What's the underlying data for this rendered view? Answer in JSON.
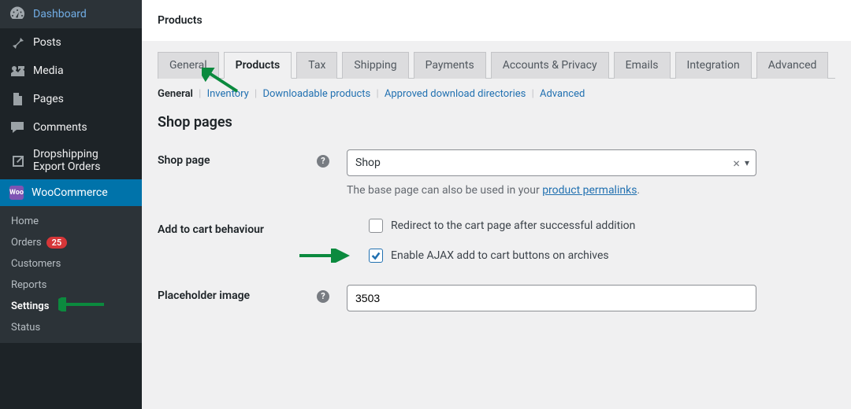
{
  "sidebar": {
    "main": [
      {
        "name": "dashboard",
        "label": "Dashboard",
        "icon": "gauge"
      },
      {
        "name": "posts",
        "label": "Posts",
        "icon": "pin"
      },
      {
        "name": "media",
        "label": "Media",
        "icon": "media"
      },
      {
        "name": "pages",
        "label": "Pages",
        "icon": "page"
      },
      {
        "name": "comments",
        "label": "Comments",
        "icon": "comment"
      },
      {
        "name": "dropshipping",
        "label": "Dropshipping Export Orders",
        "icon": "export"
      }
    ],
    "woo": {
      "label": "WooCommerce",
      "active": true
    },
    "sub": [
      {
        "name": "home",
        "label": "Home"
      },
      {
        "name": "orders",
        "label": "Orders",
        "badge": "25"
      },
      {
        "name": "customers",
        "label": "Customers"
      },
      {
        "name": "reports",
        "label": "Reports"
      },
      {
        "name": "settings",
        "label": "Settings",
        "current": true
      },
      {
        "name": "status",
        "label": "Status"
      }
    ]
  },
  "topbar": {
    "title": "Products"
  },
  "tabs": [
    {
      "label": "General"
    },
    {
      "label": "Products",
      "active": true
    },
    {
      "label": "Tax"
    },
    {
      "label": "Shipping"
    },
    {
      "label": "Payments"
    },
    {
      "label": "Accounts & Privacy"
    },
    {
      "label": "Emails"
    },
    {
      "label": "Integration"
    },
    {
      "label": "Advanced"
    }
  ],
  "subtabs": [
    {
      "label": "General",
      "current": true
    },
    {
      "label": "Inventory"
    },
    {
      "label": "Downloadable products"
    },
    {
      "label": "Approved download directories"
    },
    {
      "label": "Advanced"
    }
  ],
  "section_title": "Shop pages",
  "shop_page": {
    "label": "Shop page",
    "value": "Shop",
    "help": "The base page can also be used in your ",
    "help_link": "product permalinks",
    "help_tail": "."
  },
  "add_to_cart": {
    "label": "Add to cart behaviour",
    "redirect": {
      "checked": false,
      "text": "Redirect to the cart page after successful addition"
    },
    "ajax": {
      "checked": true,
      "text": "Enable AJAX add to cart buttons on archives"
    }
  },
  "placeholder": {
    "label": "Placeholder image",
    "value": "3503"
  }
}
